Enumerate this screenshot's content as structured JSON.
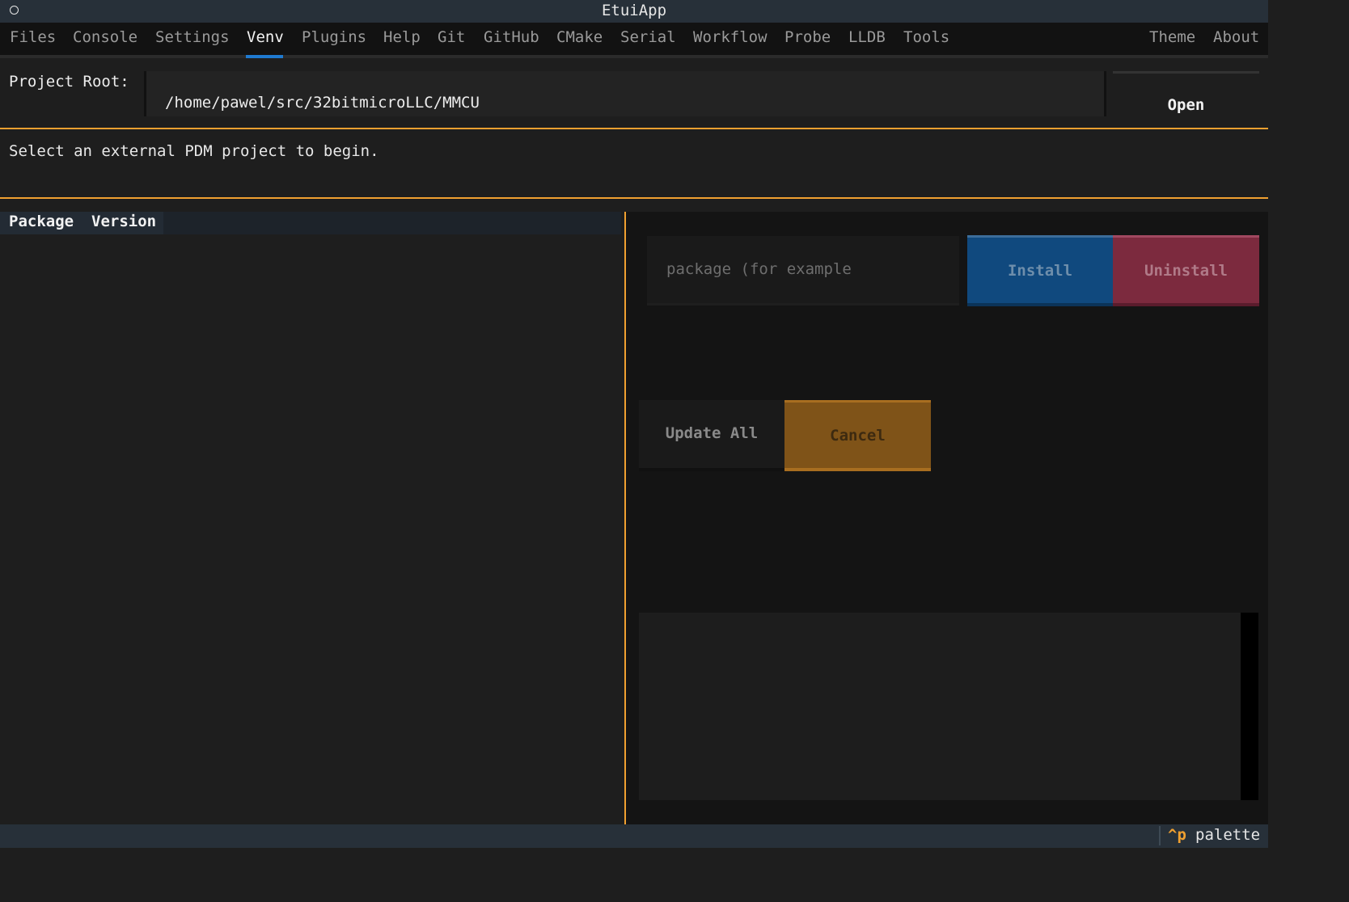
{
  "window": {
    "title": "EtuiApp"
  },
  "tabs": [
    {
      "label": "Files"
    },
    {
      "label": "Console"
    },
    {
      "label": "Settings"
    },
    {
      "label": "Venv",
      "active": true
    },
    {
      "label": "Plugins"
    },
    {
      "label": "Help"
    },
    {
      "label": "Git"
    },
    {
      "label": "GitHub"
    },
    {
      "label": "CMake"
    },
    {
      "label": "Serial"
    },
    {
      "label": "Workflow"
    },
    {
      "label": "Probe"
    },
    {
      "label": "LLDB"
    },
    {
      "label": "Tools"
    },
    {
      "label": "Theme"
    },
    {
      "label": "About"
    }
  ],
  "project_root": {
    "label": "Project Root:",
    "value": "/home/pawel/src/32bitmicroLLC/MMCU",
    "open_label": "Open"
  },
  "status": {
    "message": "Select an external PDM project to begin."
  },
  "packages_table": {
    "columns": [
      "Package",
      "Version"
    ],
    "rows": []
  },
  "actions": {
    "package_placeholder": "package (for example",
    "install_label": "Install",
    "uninstall_label": "Uninstall",
    "update_all_label": "Update All",
    "cancel_label": "Cancel"
  },
  "footer": {
    "shortcut_key": "^p",
    "shortcut_label": "palette"
  },
  "colors": {
    "accent": "#f0a030",
    "active_tab": "#1f7ad0",
    "install": "#10497e",
    "uninstall": "#7c2a3e",
    "cancel": "#7f5318"
  }
}
